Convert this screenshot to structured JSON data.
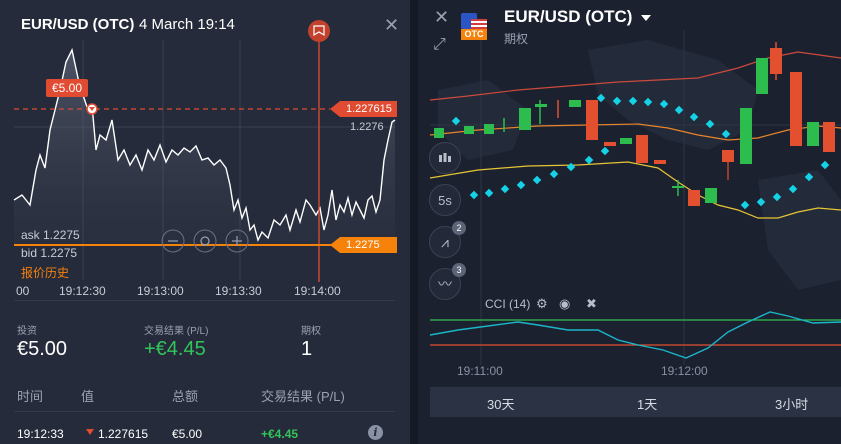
{
  "left_panel": {
    "asset": "EUR/USD (OTC)",
    "datetime": "4 March 19:14",
    "investment_tag": "€5.00",
    "strike_price_label": "1.227615",
    "grid_price_label": "1.2276",
    "current_price_label": "1.2275",
    "ask": "ask 1.2275",
    "bid": "bid 1.2275",
    "history_link": "报价历史",
    "time_ticks": [
      "00",
      "19:12:30",
      "19:13:00",
      "19:13:30",
      "19:14:00"
    ],
    "colors": {
      "price_line": "#ffffff",
      "strike_line": "#e04b32",
      "current_line": "#f5820b",
      "profit": "#33c55a"
    },
    "summary": {
      "invest_label": "投资",
      "invest_value": "€5.00",
      "result_label": "交易结果 (P/L)",
      "result_value": "+€4.45",
      "options_label": "期权",
      "options_value": "1"
    },
    "table": {
      "headers": [
        "时间",
        "值",
        "总额",
        "交易结果 (P/L)"
      ],
      "rows": [
        {
          "time": "19:12:33",
          "value": "1.227615",
          "amount": "€5.00",
          "result": "+€4.45"
        }
      ]
    },
    "icons": [
      "close-icon",
      "flag-icon",
      "zoom-out-icon",
      "crosshair-icon",
      "zoom-in-icon",
      "info-icon",
      "down-arrow-icon"
    ]
  },
  "right_panel": {
    "asset": "EUR/USD (OTC)",
    "otc_badge": "OTC",
    "subtitle": "期权",
    "indicator_label": "CCI (14)",
    "timeframe_button": "5s",
    "badge_two": "2",
    "badge_three": "3",
    "time_ticks": [
      "19:11:00",
      "19:12:00"
    ],
    "timeframes": [
      "30天",
      "1天",
      "3小时"
    ],
    "colors": {
      "up": "#2dbd4e",
      "down": "#e2502f",
      "psar": "#16d2e6",
      "band_upper": "#cc4a3c",
      "band_mid": "#e8842a",
      "band_lower": "#e6c534",
      "cci": "#1ab6c9",
      "cci_upper": "#2fbf4e",
      "cci_lower": "#e2502f"
    },
    "icons": [
      "close-icon",
      "expand-icon",
      "dropdown-caret-icon",
      "candles-icon",
      "indicator-icon",
      "drawing-icon",
      "settings-icon",
      "eye-icon",
      "remove-icon"
    ]
  }
}
